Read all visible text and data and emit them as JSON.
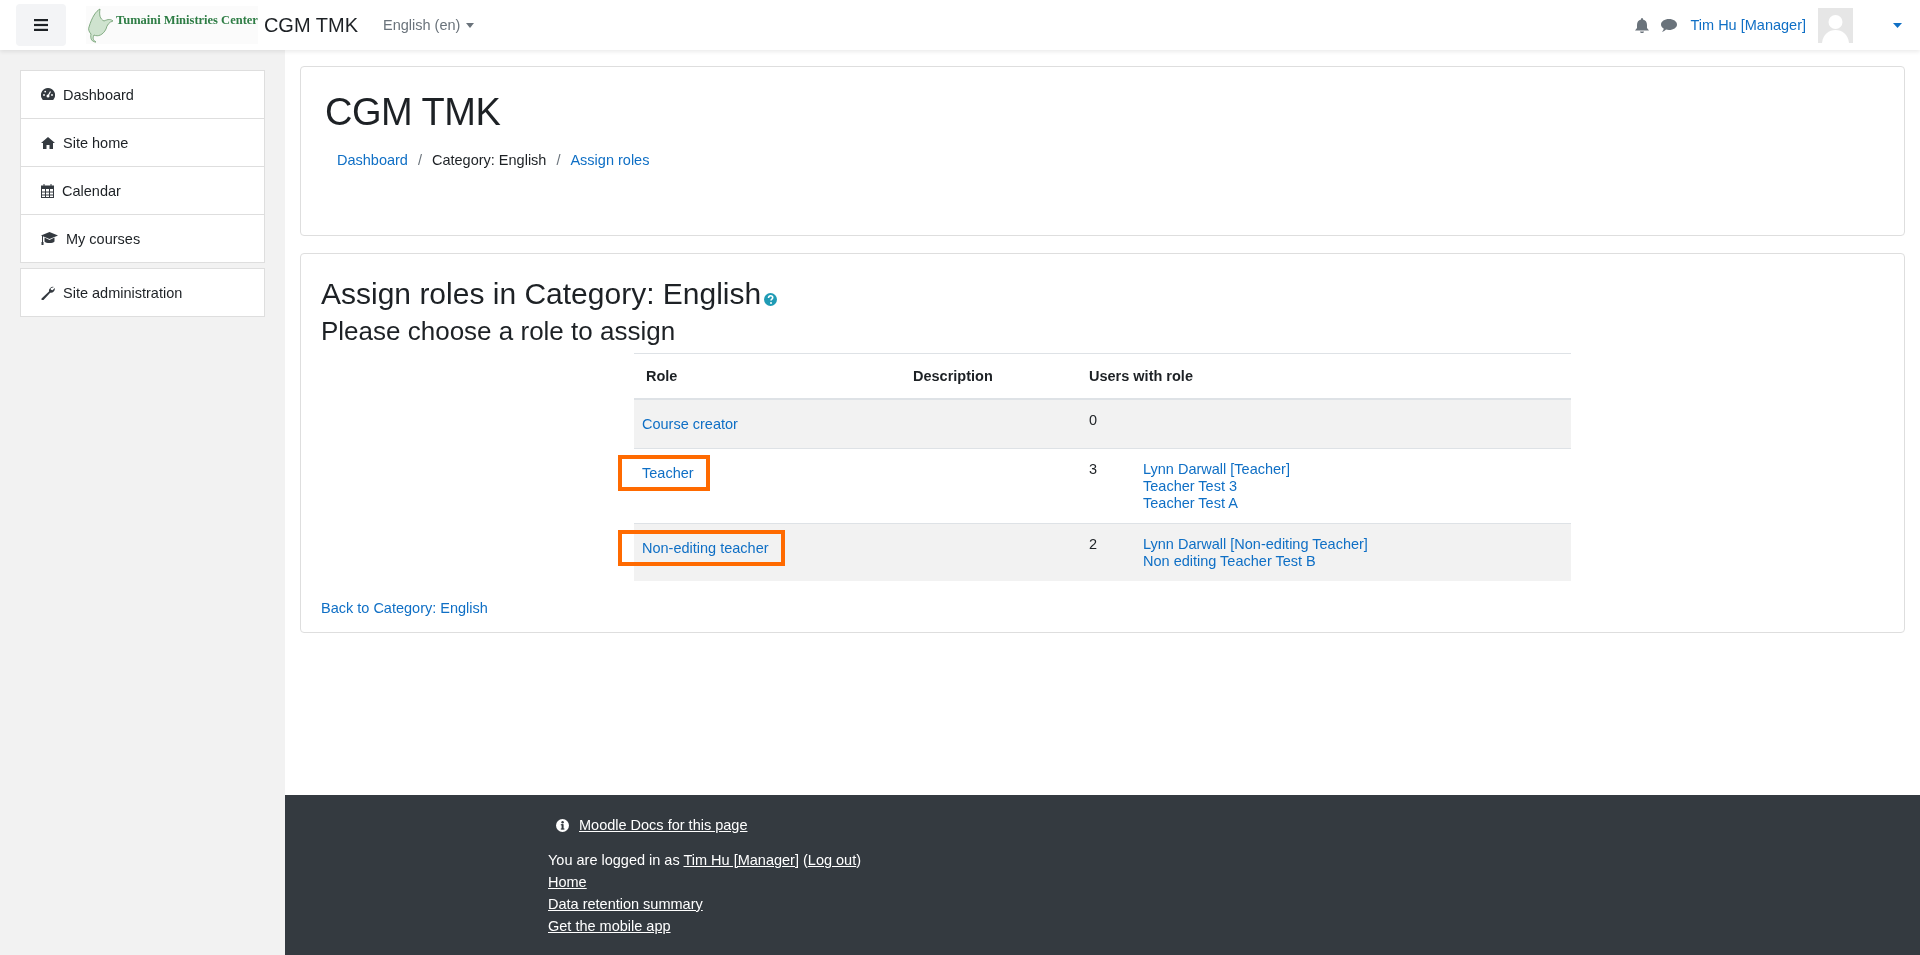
{
  "navbar": {
    "logo_text": "Tumaini Ministries Center",
    "site_name": "CGM TMK",
    "language": "English (en)",
    "user_name": "Tim Hu [Manager]"
  },
  "sidebar": {
    "groups": [
      {
        "items": [
          {
            "label": "Dashboard"
          },
          {
            "label": "Site home"
          },
          {
            "label": "Calendar"
          },
          {
            "label": "My courses"
          }
        ]
      },
      {
        "items": [
          {
            "label": "Site administration"
          }
        ]
      }
    ]
  },
  "header": {
    "title": "CGM TMK",
    "breadcrumb": [
      {
        "label": "Dashboard",
        "kind": "link"
      },
      {
        "label": "/",
        "kind": "separator"
      },
      {
        "label": "Category: English",
        "kind": "text"
      },
      {
        "label": "/",
        "kind": "separator"
      },
      {
        "label": "Assign roles",
        "kind": "link"
      }
    ]
  },
  "content": {
    "title": "Assign roles in Category: English",
    "subtitle": "Please choose a role to assign",
    "table": {
      "columns": [
        "Role",
        "Description",
        "Users with role"
      ],
      "rows": [
        {
          "role": "Course creator",
          "description": "",
          "count": "0",
          "users": [],
          "highlighted": false
        },
        {
          "role": "Teacher",
          "description": "",
          "count": "3",
          "users": [
            "Lynn Darwall [Teacher]",
            "Teacher Test 3",
            "Teacher Test A"
          ],
          "highlighted": true
        },
        {
          "role": "Non-editing teacher",
          "description": "",
          "count": "2",
          "users": [
            "Lynn Darwall [Non-editing Teacher]",
            "Non editing Teacher Test B"
          ],
          "highlighted": true
        }
      ]
    },
    "back_link": "Back to Category: English"
  },
  "footer": {
    "docs_link": "Moodle Docs for this page",
    "login": [
      {
        "text": "You are logged in as ",
        "kind": "text"
      },
      {
        "text": "Tim Hu [Manager]",
        "kind": "link"
      },
      {
        "text": " (",
        "kind": "text"
      },
      {
        "text": "Log out",
        "kind": "link"
      },
      {
        "text": ")",
        "kind": "text"
      }
    ],
    "links": [
      "Home",
      "Data retention summary",
      "Get the mobile app"
    ]
  }
}
